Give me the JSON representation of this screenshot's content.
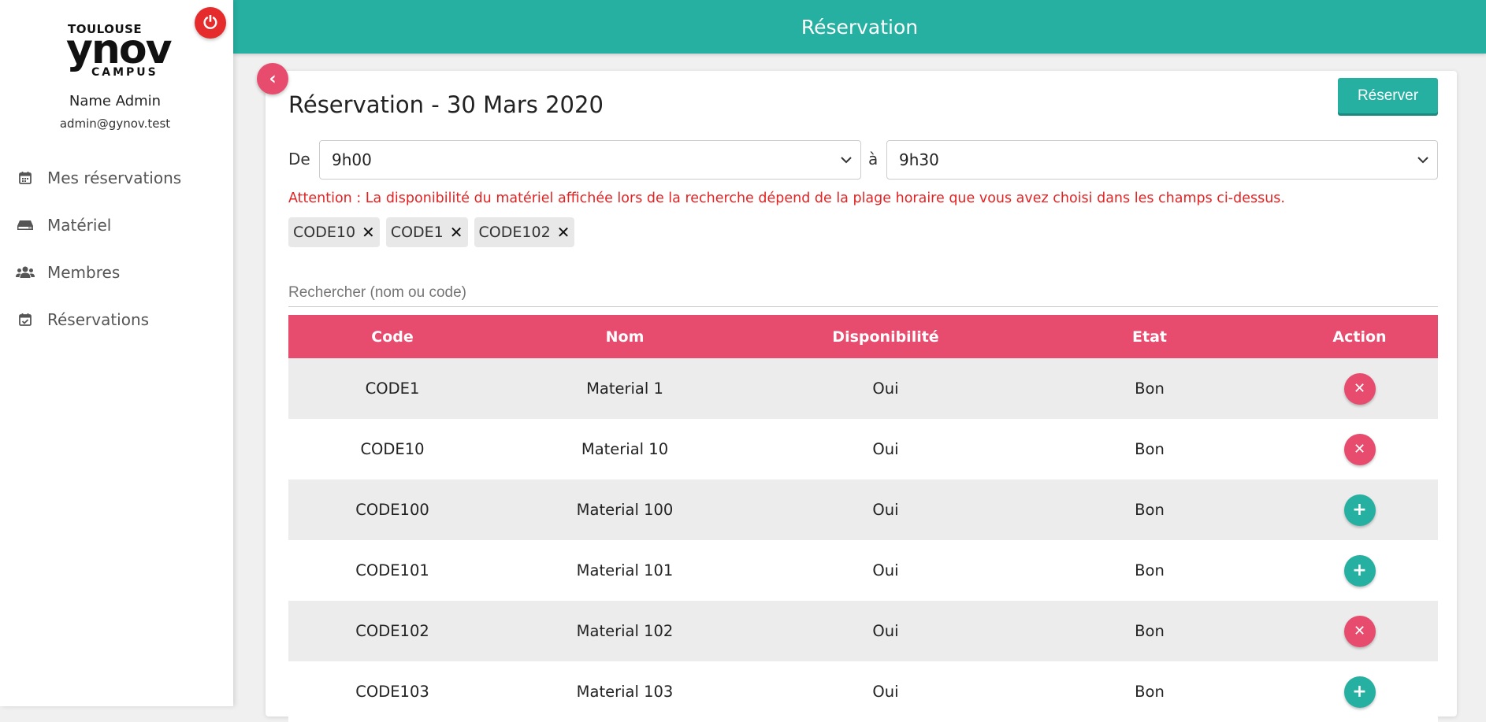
{
  "app": {
    "logo": {
      "city": "TOULOUSE",
      "brand": "ynov",
      "campus": "CAMPUS"
    },
    "user": {
      "name": "Name Admin",
      "email": "admin@gynov.test"
    }
  },
  "sidebar": {
    "items": [
      {
        "label": "Mes réservations",
        "icon": "calendar-icon"
      },
      {
        "label": "Matériel",
        "icon": "hdd-icon"
      },
      {
        "label": "Membres",
        "icon": "users-icon"
      },
      {
        "label": "Réservations",
        "icon": "calendar-check-icon"
      }
    ]
  },
  "header": {
    "title": "Réservation"
  },
  "page": {
    "title": "Réservation - 30 Mars 2020",
    "reserve_label": "Réserver",
    "from_label": "De",
    "from_value": "9h00",
    "to_label": "à",
    "to_value": "9h30",
    "warning": "Attention : La disponibilité du matériel affichée lors de la recherche dépend de la plage horaire que vous avez choisi dans les champs ci-dessus.",
    "tags": [
      "CODE10",
      "CODE1",
      "CODE102"
    ],
    "search_placeholder": "Rechercher (nom ou code)"
  },
  "table": {
    "headers": [
      "Code",
      "Nom",
      "Disponibilité",
      "Etat",
      "Action"
    ],
    "rows": [
      {
        "code": "CODE1",
        "name": "Material 1",
        "available": "Oui",
        "state": "Bon",
        "action": "remove"
      },
      {
        "code": "CODE10",
        "name": "Material 10",
        "available": "Oui",
        "state": "Bon",
        "action": "remove"
      },
      {
        "code": "CODE100",
        "name": "Material 100",
        "available": "Oui",
        "state": "Bon",
        "action": "add"
      },
      {
        "code": "CODE101",
        "name": "Material 101",
        "available": "Oui",
        "state": "Bon",
        "action": "add"
      },
      {
        "code": "CODE102",
        "name": "Material 102",
        "available": "Oui",
        "state": "Bon",
        "action": "remove"
      },
      {
        "code": "CODE103",
        "name": "Material 103",
        "available": "Oui",
        "state": "Bon",
        "action": "add"
      }
    ]
  },
  "colors": {
    "teal": "#26b0a1",
    "pink": "#e74b6d",
    "red": "#e52b2b",
    "warning": "#e52222"
  }
}
